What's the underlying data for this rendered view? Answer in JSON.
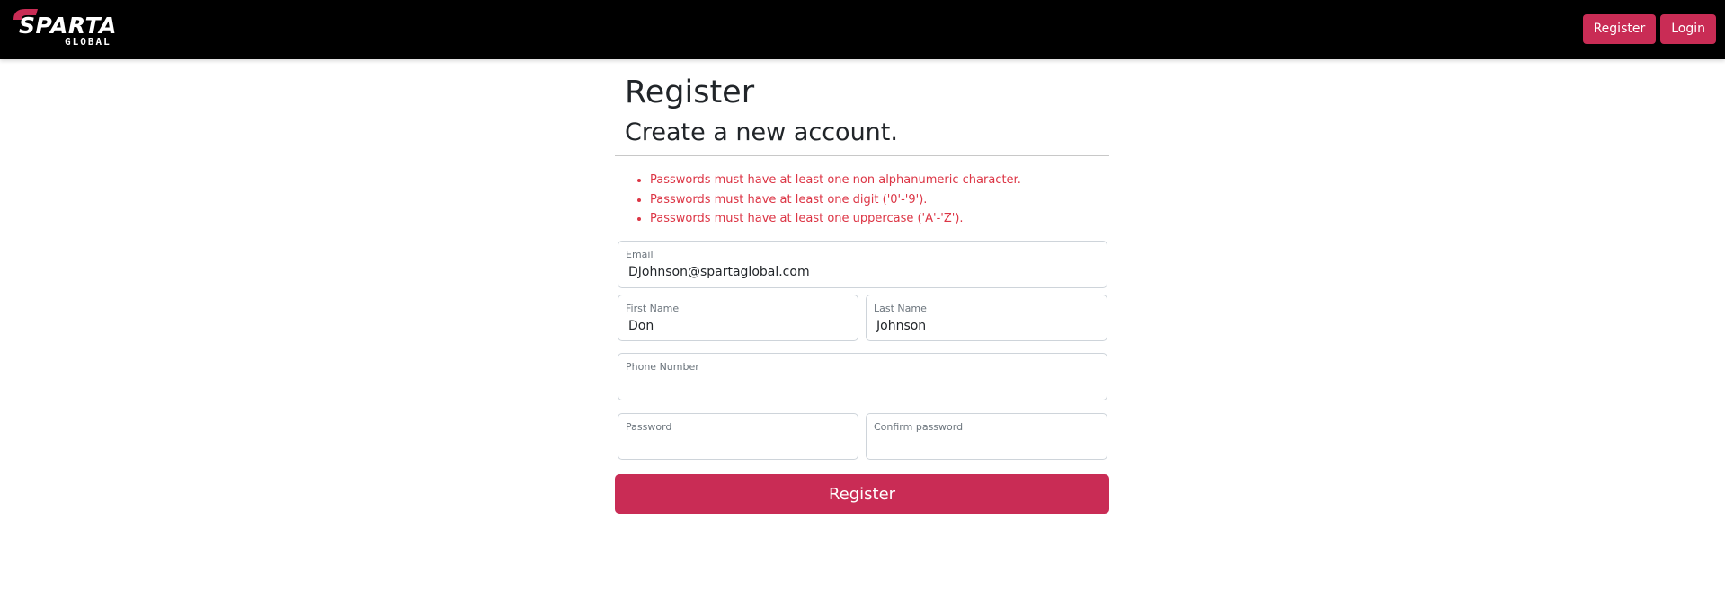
{
  "brand": {
    "name": "SPARTA",
    "sub": "GLOBAL",
    "accent_color": "#c92c55"
  },
  "nav": {
    "register_label": "Register",
    "login_label": "Login"
  },
  "page": {
    "title": "Register",
    "subtitle": "Create a new account."
  },
  "errors": [
    "Passwords must have at least one non alphanumeric character.",
    "Passwords must have at least one digit ('0'-'9').",
    "Passwords must have at least one uppercase ('A'-'Z')."
  ],
  "form": {
    "email": {
      "label": "Email",
      "value": "DJohnson@spartaglobal.com"
    },
    "first_name": {
      "label": "First Name",
      "value": "Don"
    },
    "last_name": {
      "label": "Last Name",
      "value": "Johnson"
    },
    "phone": {
      "label": "Phone Number",
      "value": ""
    },
    "password": {
      "label": "Password",
      "value": ""
    },
    "confirm_password": {
      "label": "Confirm password",
      "value": ""
    },
    "submit_label": "Register"
  }
}
